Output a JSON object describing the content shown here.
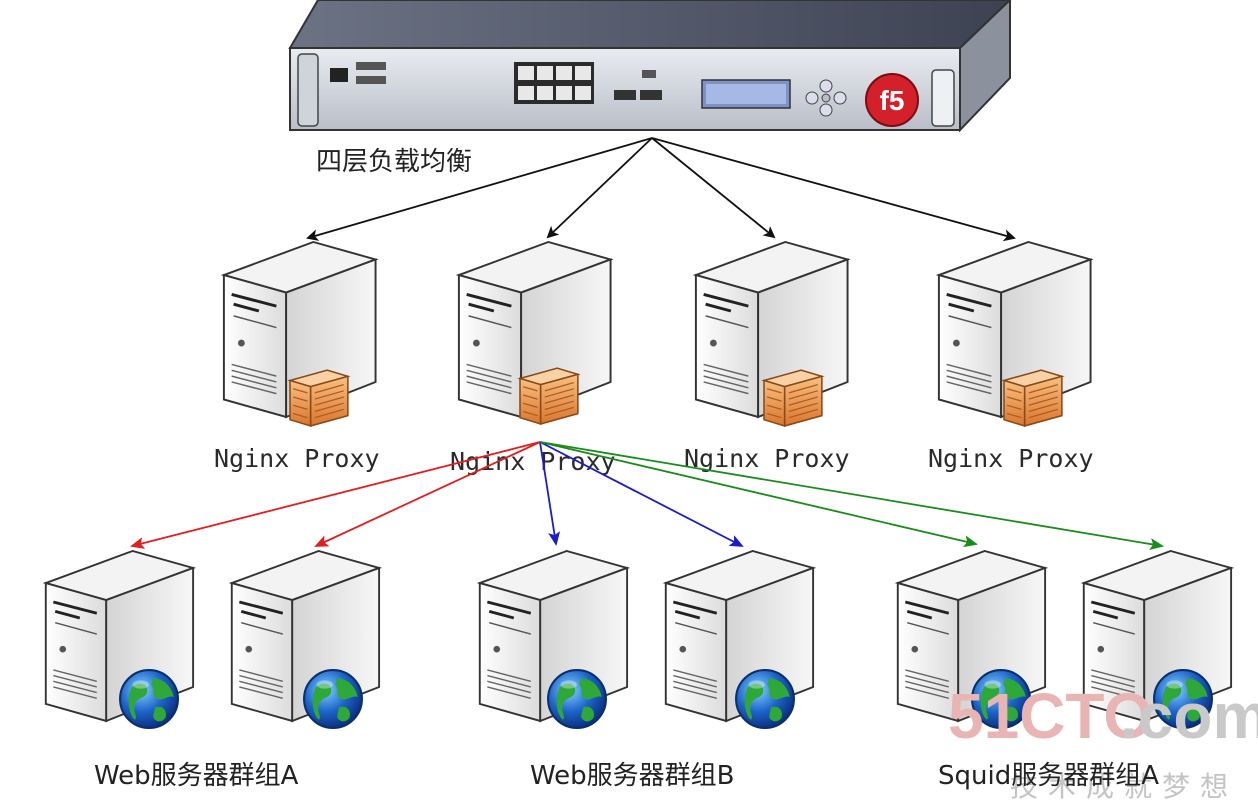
{
  "device": {
    "brand": "f5"
  },
  "labels": {
    "layer4": "四层负载均衡",
    "proxies": [
      "Nginx Proxy",
      "Nginx Proxy",
      "Nginx Proxy",
      "Nginx Proxy"
    ],
    "groups": [
      "Web服务器群组A",
      "Web服务器群组B",
      "Squid服务器群组A"
    ]
  },
  "watermark": {
    "logo_red": "51CTO",
    "logo_gray": ".com",
    "tagline": "技术成就梦想"
  },
  "colors": {
    "arrow_black": "#111111",
    "arrow_red": "#e02020",
    "arrow_blue": "#1c1ccc",
    "arrow_green": "#1a8c1a",
    "brand_red": "#d4202a"
  },
  "icons": {
    "proxy_server": "server-firewall-icon",
    "web_server": "server-globe-icon",
    "load_balancer": "rack-appliance-icon"
  }
}
